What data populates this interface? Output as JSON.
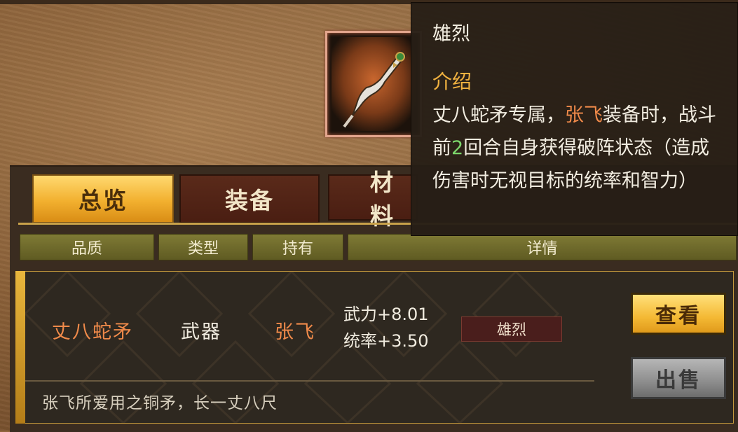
{
  "item": {
    "icon": "serpent-spear-icon"
  },
  "tabs": [
    {
      "label": "总览",
      "active": true
    },
    {
      "label": "装备",
      "active": false
    },
    {
      "label": "材料",
      "active": false
    }
  ],
  "columns": {
    "quality": "品质",
    "type": "类型",
    "holder": "持有",
    "details": "详情"
  },
  "row": {
    "name": "丈八蛇矛",
    "type": "武器",
    "holder": "张飞",
    "stat1": "武力+8.01",
    "stat2": "统率+3.50",
    "skill": "雄烈",
    "description": "张飞所爱用之铜矛，长一丈八尺"
  },
  "buttons": {
    "view": "查看",
    "sell": "出售"
  },
  "tooltip": {
    "title": "雄烈",
    "heading": "介绍",
    "text_part1": "丈八蛇矛专属，",
    "text_highlight_name": "张飞",
    "text_part2": "装备时，战斗前",
    "text_highlight_num": "2",
    "text_part3": "回合自身获得破阵状态（造成伤害时无视目标的统率和智力）"
  },
  "colors": {
    "accent_gold": "#f2b02f",
    "highlight_orange": "#f08a4a",
    "highlight_green": "#7cd66b"
  }
}
